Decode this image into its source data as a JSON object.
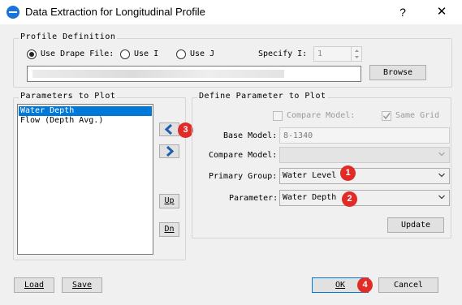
{
  "window": {
    "title": "Data Extraction for Longitudinal Profile",
    "help_label": "?",
    "close_label": "✕"
  },
  "profile_definition": {
    "legend": "Profile Definition",
    "use_drape_file": "Use Drape File:",
    "use_i": "Use I",
    "use_j": "Use J",
    "selected": "use_drape_file",
    "specify_i_label": "Specify I:",
    "specify_i_value": "1",
    "browse_label": "Browse"
  },
  "parameters_to_plot": {
    "legend": "Parameters to Plot",
    "items": [
      "Water Depth",
      "Flow (Depth Avg.)"
    ],
    "selected_index": 0
  },
  "side_buttons": {
    "up_label": "Up",
    "dn_label": "Dn"
  },
  "define_parameter": {
    "legend": "Define Parameter to Plot",
    "compare_model_check": "Compare Model:",
    "same_grid_check": "Same Grid",
    "base_model_label": "Base Model:",
    "base_model_value": "8-1340",
    "compare_model_label": "Compare Model:",
    "compare_model_value": "",
    "primary_group_label": "Primary Group:",
    "primary_group_value": "Water Level",
    "parameter_label": "Parameter:",
    "parameter_value": "Water Depth",
    "update_label": "Update"
  },
  "footer": {
    "load_label": "Load",
    "save_label": "Save",
    "ok_label": "OK",
    "cancel_label": "Cancel"
  },
  "badges": [
    "1",
    "2",
    "3",
    "4"
  ],
  "colors": {
    "badge": "#e02b27",
    "selection": "#0078d7",
    "arrow": "#1f5fae",
    "app_icon": "#1a73d9"
  }
}
